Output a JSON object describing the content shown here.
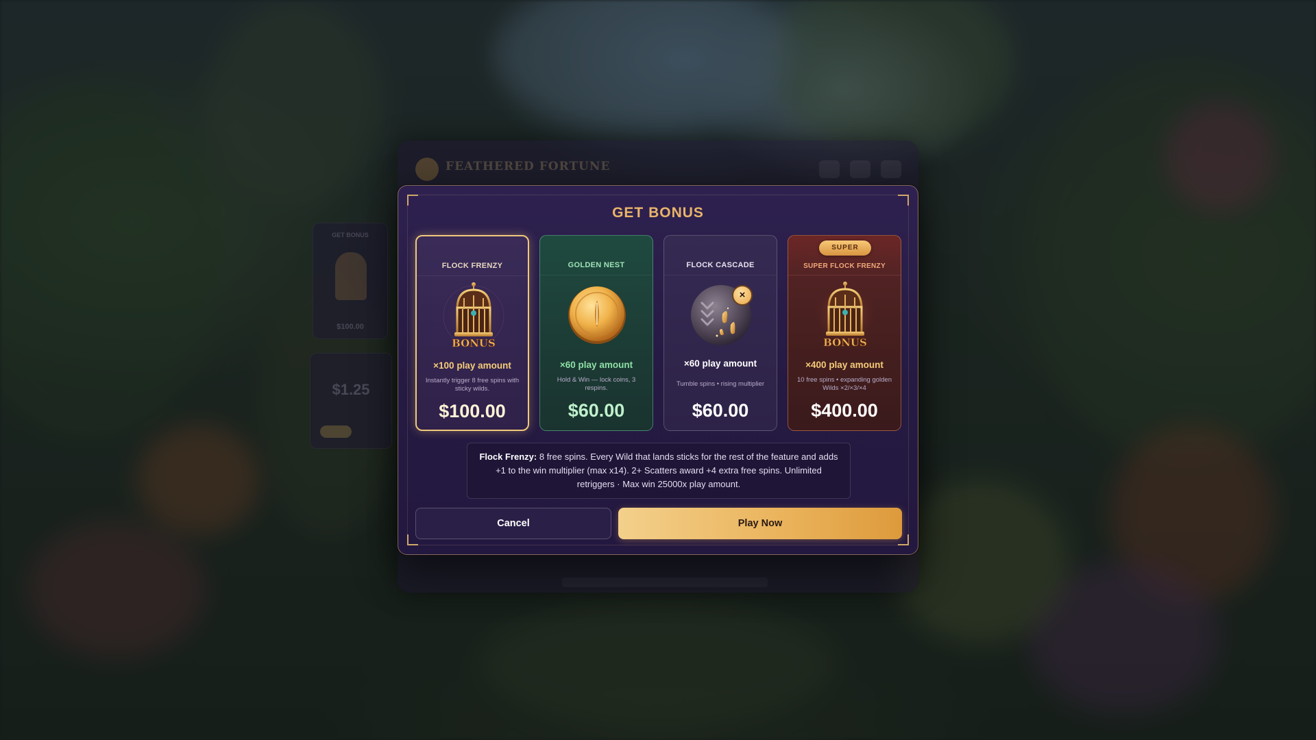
{
  "underlay": {
    "game_title": "FEATHERED FORTUNE",
    "side_card_title": "GET BONUS",
    "side_card_price": "$100.00",
    "side_bet_value": "$1.25"
  },
  "modal": {
    "title": "GET BONUS",
    "cards": [
      {
        "name": "FLOCK FRENZY",
        "multiplier": "×100 play amount",
        "description": "Instantly trigger 8 free spins with sticky wilds.",
        "price": "$100.00",
        "selected": true,
        "art_icon": "bonus-cage-icon",
        "art_label": "BONUS"
      },
      {
        "name": "GOLDEN NEST",
        "multiplier": "×60 play amount",
        "description": "Hold & Win — lock coins, 3 respins.",
        "price": "$60.00",
        "selected": false,
        "art_icon": "gold-coin-icon"
      },
      {
        "name": "FLOCK CASCADE",
        "multiplier": "×60 play amount",
        "description": "Tumble spins • rising multiplier",
        "price": "$60.00",
        "selected": false,
        "art_icon": "cascade-orb-icon",
        "art_badge": "×"
      },
      {
        "name": "SUPER FLOCK FRENZY",
        "badge": "SUPER",
        "multiplier": "×400 play amount",
        "description": "10 free spins • expanding golden Wilds ×2/×3/×4",
        "price": "$400.00",
        "selected": false,
        "art_icon": "bonus-cage-icon",
        "art_label": "BONUS"
      }
    ],
    "info": {
      "feature_name": "Flock Frenzy:",
      "text": " 8 free spins. Every Wild that lands sticks for the rest of the feature and adds +1 to the win multiplier (max x14). 2+ Scatters award +4 extra free spins. Unlimited retriggers · Max win 25000x play amount."
    },
    "buttons": {
      "cancel": "Cancel",
      "play": "Play Now"
    }
  },
  "colors": {
    "accent_gold": "#e9b46a",
    "modal_bg": "#2e2150",
    "selected_border": "#f1c97a",
    "golden_nest_green": "#8ee0a6",
    "super_red": "#5a2528"
  }
}
